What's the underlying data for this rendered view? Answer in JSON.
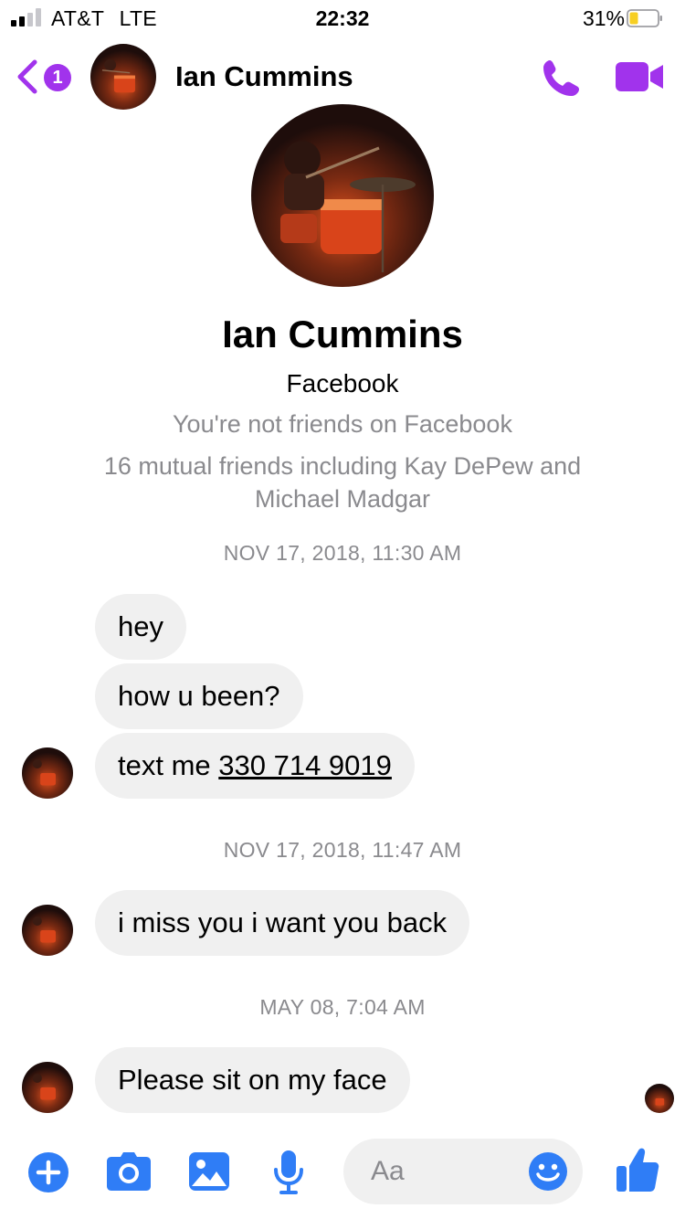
{
  "status_bar": {
    "carrier": "AT&T",
    "network": "LTE",
    "time": "22:32",
    "battery_percent": "31%",
    "battery_level": 0.31,
    "signal_bars_active": 2,
    "signal_bars_total": 4
  },
  "header": {
    "unread_count": "1",
    "contact_name": "Ian Cummins",
    "icons": [
      "chevron-left-icon",
      "phone-icon",
      "video-camera-icon"
    ]
  },
  "profile": {
    "name": "Ian Cummins",
    "source": "Facebook",
    "friend_status": "You're not friends on Facebook",
    "mutual_friends_line1": "16 mutual friends including Kay DePew and",
    "mutual_friends_line2": "Michael Madgar"
  },
  "conversation": {
    "groups": [
      {
        "timestamp": "NOV 17, 2018, 11:30 AM",
        "messages": [
          {
            "text": "hey"
          },
          {
            "text": "how u been?"
          },
          {
            "prefix": "text me ",
            "link": "330 714 9019"
          }
        ]
      },
      {
        "timestamp": "NOV 17, 2018, 11:47 AM",
        "messages": [
          {
            "text": "i miss you i want you back"
          }
        ]
      },
      {
        "timestamp": "MAY 08, 7:04 AM",
        "messages": [
          {
            "text": "Please sit on my face"
          }
        ]
      }
    ]
  },
  "composer": {
    "placeholder": "Aa",
    "icons": [
      "plus-icon",
      "camera-icon",
      "image-icon",
      "microphone-icon",
      "emoji-icon",
      "thumbs-up-icon"
    ]
  },
  "colors": {
    "accent_purple": "#a133ec",
    "composer_blue": "#2f7df6",
    "bubble_gray": "#f0f0f0",
    "meta_gray": "#8a8a8e",
    "battery_yellow": "#f7cf23"
  }
}
